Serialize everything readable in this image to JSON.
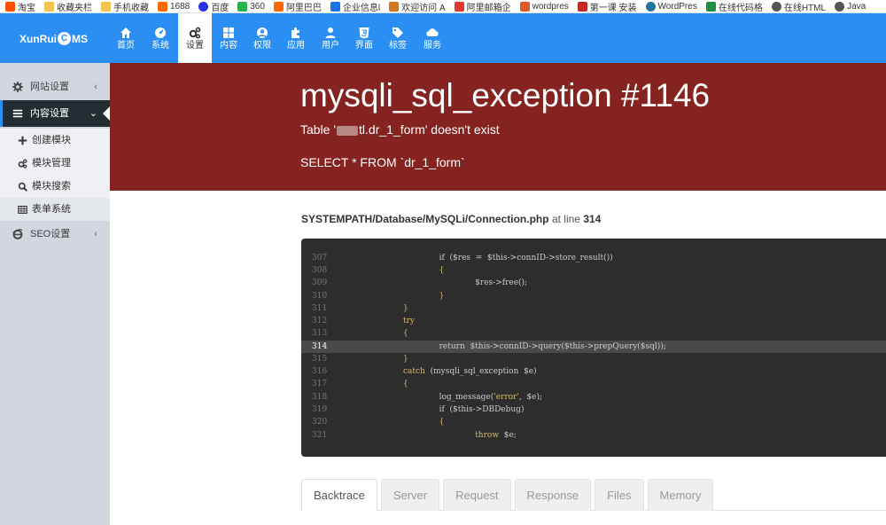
{
  "bookmarks": [
    {
      "icon": "taobao-icon",
      "label": "淘宝",
      "color": "#ff5000"
    },
    {
      "icon": "folder-icon",
      "label": "收藏夹栏",
      "color": "#f3c24f"
    },
    {
      "icon": "folder-icon",
      "label": "手机收藏",
      "color": "#f3c24f"
    },
    {
      "icon": "site-1688-icon",
      "label": "1688",
      "color": "#ff6a00"
    },
    {
      "icon": "baidu-icon",
      "label": "百度",
      "color": "#2932e1"
    },
    {
      "icon": "site-360-icon",
      "label": "360",
      "color": "#2ab24b"
    },
    {
      "icon": "alibaba-icon",
      "label": "阿里巴巴",
      "color": "#ff6a00"
    },
    {
      "icon": "qixin-icon",
      "label": "企业信息l",
      "color": "#1a73e8"
    },
    {
      "icon": "welcome-icon",
      "label": "欢迎访问 A",
      "color": "#d4761b"
    },
    {
      "icon": "aliyun-mail-icon",
      "label": "阿里邮箱企",
      "color": "#e0392b"
    },
    {
      "icon": "wordpress-c-icon",
      "label": "wordpres",
      "color": "#e05a2a"
    },
    {
      "icon": "lesson-icon",
      "label": "第一课 安装",
      "color": "#c62828"
    },
    {
      "icon": "wordpress-icon",
      "label": "WordPres",
      "color": "#21759b"
    },
    {
      "icon": "online-code-icon",
      "label": "在线代码格",
      "color": "#1e8f3e"
    },
    {
      "icon": "globe-icon",
      "label": "在线HTML",
      "color": "#555555"
    },
    {
      "icon": "globe-icon",
      "label": "Java",
      "color": "#555555"
    }
  ],
  "brand": {
    "prefix": "XunRui",
    "c": "C",
    "suffix": "MS"
  },
  "nav": [
    {
      "label": "首页",
      "icon": "home-icon"
    },
    {
      "label": "系统",
      "icon": "dashboard-icon"
    },
    {
      "label": "设置",
      "icon": "cogs-icon",
      "active": true
    },
    {
      "label": "内容",
      "icon": "th-large-icon"
    },
    {
      "label": "权限",
      "icon": "user-circle-icon"
    },
    {
      "label": "应用",
      "icon": "puzzle-icon"
    },
    {
      "label": "用户",
      "icon": "user-icon"
    },
    {
      "label": "界面",
      "icon": "html5-icon"
    },
    {
      "label": "标签",
      "icon": "tag-icon"
    },
    {
      "label": "服务",
      "icon": "cloud-icon"
    }
  ],
  "sidebar": {
    "items": [
      {
        "label": "网站设置",
        "icon": "cog-icon",
        "chevron": "‹"
      },
      {
        "label": "内容设置",
        "icon": "list-icon",
        "chevron": "⌄",
        "active": true
      },
      {
        "label": "创建模块",
        "icon": "plus-icon",
        "sub": true
      },
      {
        "label": "模块管理",
        "icon": "cogs-icon",
        "sub": true
      },
      {
        "label": "模块搜索",
        "icon": "search-icon",
        "sub": true
      },
      {
        "label": "表单系统",
        "icon": "table-icon",
        "sub": true,
        "highlighted": true
      },
      {
        "label": "SEO设置",
        "icon": "ie-icon",
        "chevron": "‹"
      }
    ]
  },
  "error": {
    "title": "mysqli_sql_exception #1146",
    "message_prefix": "Table '",
    "message_suffix": "tl.dr_1_form' doesn't exist",
    "sql": "SELECT * FROM `dr_1_form`"
  },
  "source": {
    "path": "SYSTEMPATH/Database/MySQLi/Connection.php",
    "at_line_text": "at line",
    "line": "314"
  },
  "code_lines": [
    {
      "n": "307",
      "indent": 7,
      "tokens": [
        {
          "t": "if  ($res  =  $this->connID->store_result())",
          "k": false
        }
      ]
    },
    {
      "n": "308",
      "indent": 7,
      "tokens": [
        {
          "t": "{",
          "k": true
        }
      ]
    },
    {
      "n": "309",
      "indent": 9,
      "tokens": [
        {
          "t": "$res->free();",
          "k": false
        }
      ]
    },
    {
      "n": "310",
      "indent": 7,
      "tokens": [
        {
          "t": "}",
          "k": true
        }
      ]
    },
    {
      "n": "311",
      "indent": 5,
      "tokens": [
        {
          "t": "}",
          "k": true
        }
      ]
    },
    {
      "n": "312",
      "indent": 5,
      "tokens": [
        {
          "t": "try",
          "k": true
        }
      ]
    },
    {
      "n": "313",
      "indent": 5,
      "tokens": [
        {
          "t": "{",
          "k": true
        }
      ]
    },
    {
      "n": "314",
      "indent": 7,
      "hl": true,
      "tokens": [
        {
          "t": "return  $this->connID->query($this->prepQuery($sql));",
          "k": false
        }
      ]
    },
    {
      "n": "315",
      "indent": 5,
      "tokens": [
        {
          "t": "}",
          "k": true
        }
      ]
    },
    {
      "n": "316",
      "indent": 5,
      "tokens": [
        {
          "t": "catch",
          "k": true
        },
        {
          "t": "  (mysqli_sql_exception  $e)",
          "k": false
        }
      ]
    },
    {
      "n": "317",
      "indent": 5,
      "tokens": [
        {
          "t": "{",
          "k": true
        }
      ]
    },
    {
      "n": "318",
      "indent": 7,
      "tokens": [
        {
          "t": "log_message(",
          "k": false
        },
        {
          "t": "'error'",
          "k": true
        },
        {
          "t": ",  $e);",
          "k": false
        }
      ]
    },
    {
      "n": "319",
      "indent": 7,
      "tokens": [
        {
          "t": "if  ($this->DBDebug)",
          "k": false
        }
      ]
    },
    {
      "n": "320",
      "indent": 7,
      "tokens": [
        {
          "t": "{",
          "k": true
        }
      ]
    },
    {
      "n": "321",
      "indent": 9,
      "tokens": [
        {
          "t": "throw",
          "k": true
        },
        {
          "t": "  $e;",
          "k": false
        }
      ]
    }
  ],
  "tabs": [
    {
      "label": "Backtrace",
      "active": true
    },
    {
      "label": "Server"
    },
    {
      "label": "Request"
    },
    {
      "label": "Response"
    },
    {
      "label": "Files"
    },
    {
      "label": "Memory"
    }
  ],
  "colors": {
    "nav": "#2b8ef2",
    "error_bg": "#84231f",
    "sidebar": "#d2d6de",
    "code_bg": "#2d2d2d"
  }
}
